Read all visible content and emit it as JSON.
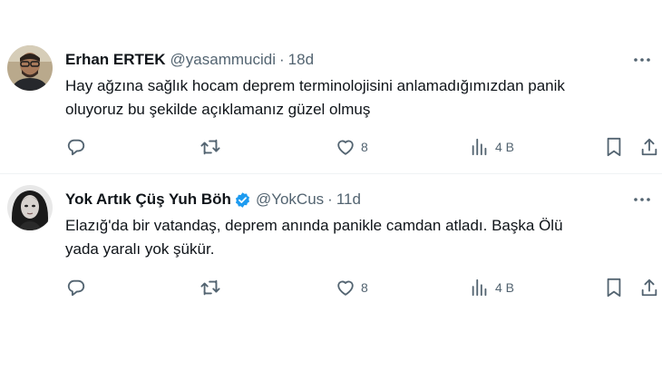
{
  "tweets": [
    {
      "name": "Erhan ERTEK",
      "handle": "@yasammucidi",
      "separator": "·",
      "time": "18d",
      "verified": false,
      "text_line1": "Hay ağzına sağlık hocam deprem terminolojisini anlamadığımızdan panik",
      "text_line2": "oluyoruz bu şekilde açıklamanız güzel olmuş",
      "likes": "8",
      "views": "4 B"
    },
    {
      "name": "Yok Artık Çüş Yuh Böh",
      "handle": "@YokCus",
      "separator": "·",
      "time": "11d",
      "verified": true,
      "text_line1": "Elazığ'da bir vatandaş, deprem anında panikle camdan atladı. Başka Ölü",
      "text_line2": "yada yaralı yok şükür.",
      "likes": "8",
      "views": "4 B"
    }
  ],
  "icons": {
    "reply": "reply-icon",
    "retweet": "retweet-icon",
    "like": "heart-icon",
    "views": "bar-chart-icon",
    "bookmark": "bookmark-icon",
    "share": "share-icon",
    "more": "more-dots-icon",
    "verified": "verified-badge-icon"
  },
  "colors": {
    "text_primary": "#0f1419",
    "text_secondary": "#536471",
    "verified_blue": "#1d9bf0",
    "divider": "#eff3f4"
  }
}
